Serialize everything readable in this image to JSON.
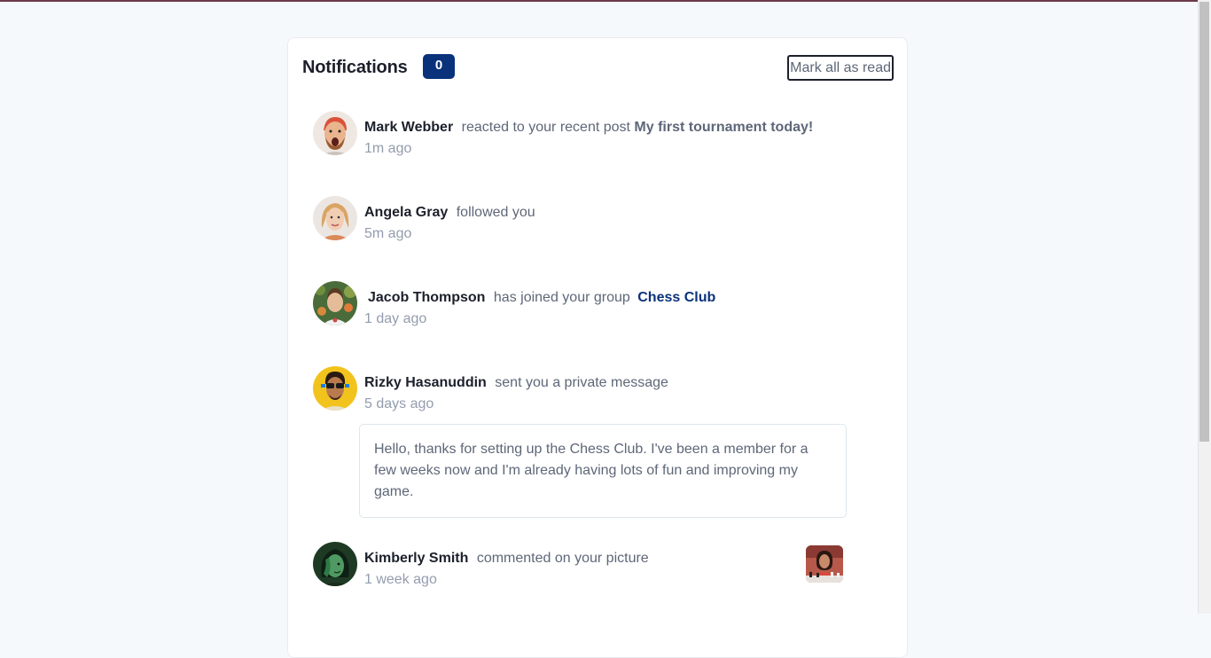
{
  "header": {
    "title": "Notifications",
    "unread_count": "0",
    "mark_all_label": "Mark all as read"
  },
  "colors": {
    "accent": "#0a327b",
    "text_dark": "#1c202b",
    "text_muted": "#5e6778",
    "text_time": "#939cad"
  },
  "notifications": [
    {
      "name": "Mark Webber",
      "action": "reacted to your recent post",
      "post": "My first tournament today!",
      "time": "1m ago",
      "avatar_icon": "avatar-mark-webber"
    },
    {
      "name": "Angela Gray",
      "action": "followed you",
      "time": "5m ago",
      "avatar_icon": "avatar-angela-gray"
    },
    {
      "name": "Jacob Thompson",
      "action": "has joined your group",
      "group": "Chess Club",
      "time": "1 day ago",
      "avatar_icon": "avatar-jacob-thompson"
    },
    {
      "name": "Rizky Hasanuddin",
      "action": "sent you a private message",
      "time": "5 days ago",
      "message": "Hello, thanks for setting up the Chess Club. I've been a member for a few weeks now and I'm already having lots of fun and improving my game.",
      "avatar_icon": "avatar-rizky-hasanuddin"
    },
    {
      "name": "Kimberly Smith",
      "action": "commented on your picture",
      "time": "1 week ago",
      "avatar_icon": "avatar-kimberly-smith",
      "picture_icon": "chess-picture-thumbnail"
    }
  ]
}
